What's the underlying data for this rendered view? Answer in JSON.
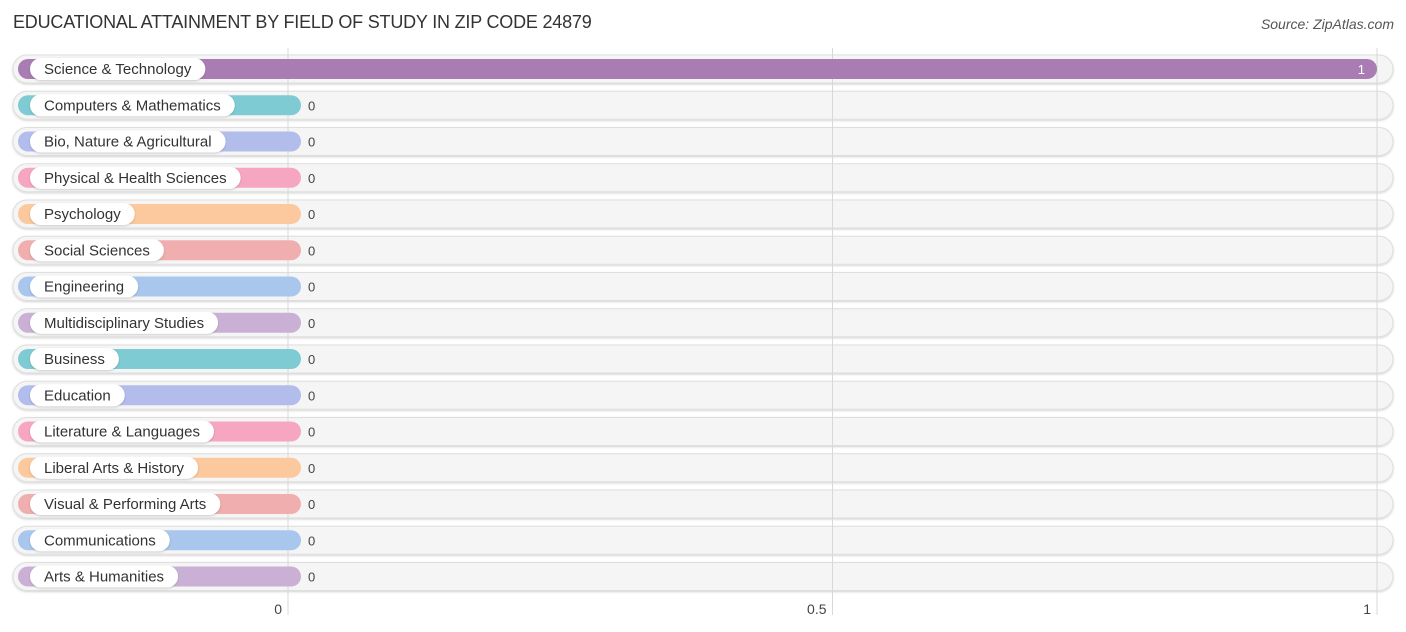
{
  "header": {
    "title": "EDUCATIONAL ATTAINMENT BY FIELD OF STUDY IN ZIP CODE 24879",
    "source": "Source: ZipAtlas.com"
  },
  "chart_data": {
    "type": "bar",
    "orientation": "horizontal",
    "title": "EDUCATIONAL ATTAINMENT BY FIELD OF STUDY IN ZIP CODE 24879",
    "xlabel": "",
    "ylabel": "",
    "xlim": [
      0,
      1
    ],
    "grid": true,
    "x_ticks": [
      0,
      0.5,
      1
    ],
    "x_tick_labels": [
      "0",
      "0.5",
      "1"
    ],
    "categories": [
      "Science & Technology",
      "Computers & Mathematics",
      "Bio, Nature & Agricultural",
      "Physical & Health Sciences",
      "Psychology",
      "Social Sciences",
      "Engineering",
      "Multidisciplinary Studies",
      "Business",
      "Education",
      "Literature & Languages",
      "Liberal Arts & History",
      "Visual & Performing Arts",
      "Communications",
      "Arts & Humanities"
    ],
    "values": [
      1,
      0,
      0,
      0,
      0,
      0,
      0,
      0,
      0,
      0,
      0,
      0,
      0,
      0,
      0
    ],
    "value_labels": [
      "1",
      "0",
      "0",
      "0",
      "0",
      "0",
      "0",
      "0",
      "0",
      "0",
      "0",
      "0",
      "0",
      "0",
      "0"
    ],
    "colors": [
      "#a97db4",
      "#7ecbd3",
      "#b3bdeb",
      "#f6a6c1",
      "#fbc99d",
      "#f0aeae",
      "#a9c6ec",
      "#cbb0d6",
      "#7ecbd3",
      "#b3bdeb",
      "#f6a6c1",
      "#fbc99d",
      "#f0aeae",
      "#a9c6ec",
      "#cbb0d6"
    ]
  }
}
